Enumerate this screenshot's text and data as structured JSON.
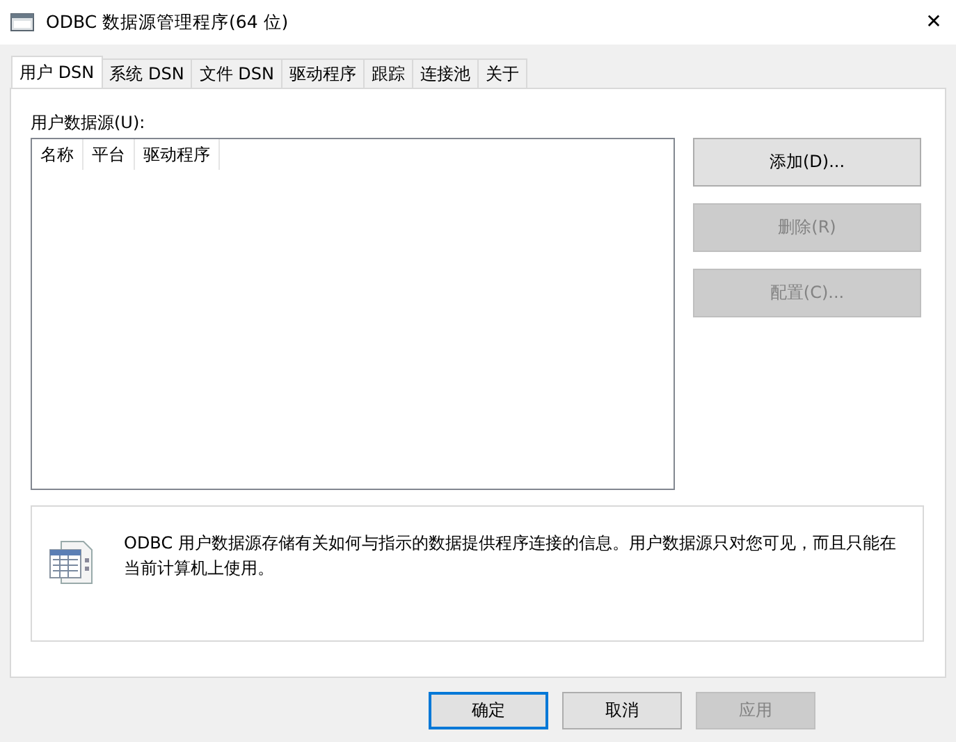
{
  "window": {
    "title": "ODBC 数据源管理程序(64 位)",
    "close": "✕"
  },
  "tabs": [
    {
      "label": "用户 DSN",
      "selected": true
    },
    {
      "label": "系统 DSN",
      "selected": false
    },
    {
      "label": "文件 DSN",
      "selected": false
    },
    {
      "label": "驱动程序",
      "selected": false
    },
    {
      "label": "跟踪",
      "selected": false
    },
    {
      "label": "连接池",
      "selected": false
    },
    {
      "label": "关于",
      "selected": false
    }
  ],
  "list_label": "用户数据源(U):",
  "table": {
    "columns": [
      "名称",
      "平台",
      "驱动程序"
    ]
  },
  "side_buttons": [
    {
      "label": "添加(D)...",
      "disabled": false
    },
    {
      "label": "删除(R)",
      "disabled": true
    },
    {
      "label": "配置(C)...",
      "disabled": true
    }
  ],
  "info": "ODBC 用户数据源存储有关如何与指示的数据提供程序连接的信息。用户数据源只对您可见，而且只能在当前计算机上使用。",
  "footer_buttons": [
    {
      "label": "确定",
      "disabled": false,
      "default": true
    },
    {
      "label": "取消",
      "disabled": false,
      "default": false
    },
    {
      "label": "应用",
      "disabled": true,
      "default": false
    }
  ]
}
